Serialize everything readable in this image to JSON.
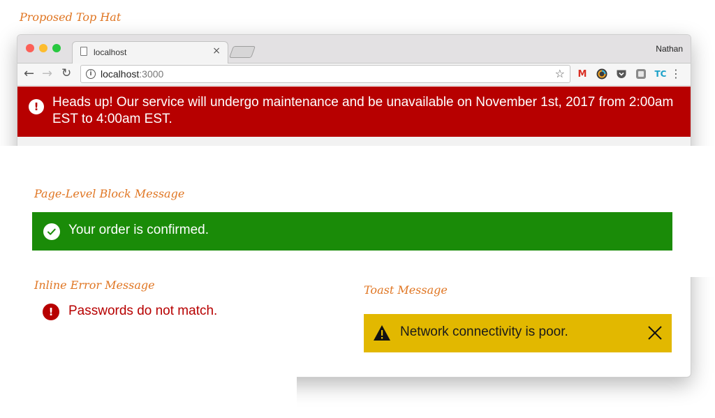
{
  "captions": {
    "top_hat": "Proposed Top Hat",
    "block": "Page-Level Block Message",
    "inline": "Inline Error Message",
    "toast": "Toast Message"
  },
  "browser": {
    "tab_title": "localhost",
    "tab_close": "×",
    "user_name": "Nathan",
    "url_host": "localhost",
    "url_port": ":3000",
    "info_icon": "i",
    "extension_icons": [
      "gmail-icon",
      "color-wheel-icon",
      "pocket-icon",
      "evernote-icon",
      "tc-icon"
    ]
  },
  "maintenance_banner": {
    "icon_glyph": "!",
    "text": "Heads up! Our service will undergo maintenance and be unavailable on November 1st, 2017 from 2:00am EST to 4:00am EST.",
    "color": "#b70000"
  },
  "block_message": {
    "text": "Your order is confirmed.",
    "color": "#1a8b08"
  },
  "inline_error": {
    "icon_glyph": "!",
    "text": "Passwords do not match.",
    "color": "#b70000"
  },
  "toast": {
    "text": "Network connectivity is poor.",
    "color": "#e2b800"
  },
  "accent_caption_color": "#e07623"
}
